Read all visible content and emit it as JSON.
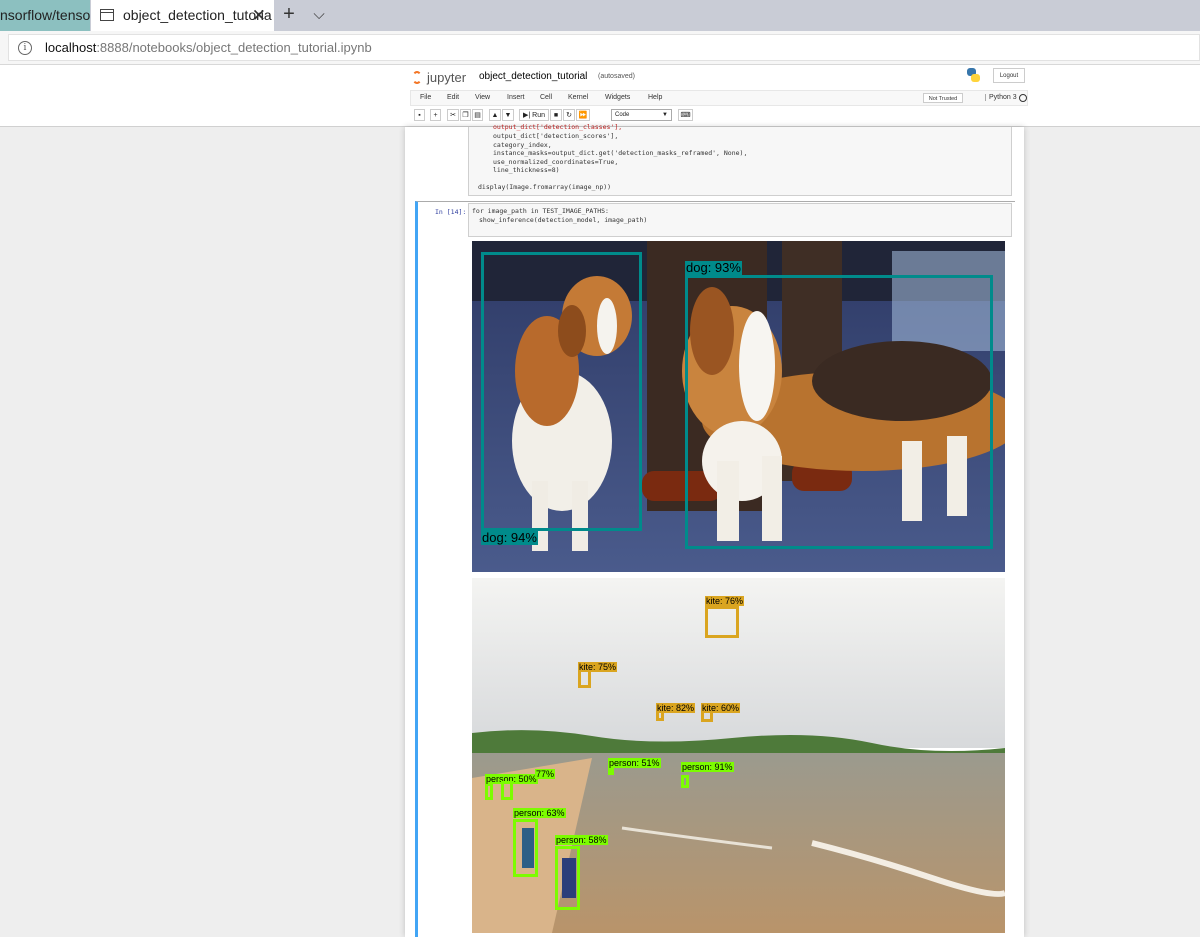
{
  "browser": {
    "tabs": [
      {
        "title": "nsorflow/tensorf"
      },
      {
        "title": "object_detection_tutoria"
      }
    ],
    "new_tab_symbol": "+",
    "tab_list_symbol": "⌵",
    "close_symbol": "✕",
    "url_host": "localhost",
    "url_path": ":8888/notebooks/object_detection_tutorial.ipynb"
  },
  "jupyter": {
    "logo_text": "jupyter",
    "notebook_name": "object_detection_tutorial",
    "save_status": "(autosaved)",
    "logout_label": "Logout",
    "menu": [
      "File",
      "Edit",
      "View",
      "Insert",
      "Cell",
      "Kernel",
      "Widgets",
      "Help"
    ],
    "trust_label": "Not Trusted",
    "kernel_name": "Python 3",
    "toolbar": {
      "run_label": "Run",
      "cell_type": "Code"
    }
  },
  "cells": {
    "prev_code_lines": [
      "output_dict['detection_classes'],",
      "output_dict['detection_scores'],",
      "category_index,",
      "instance_masks=output_dict.get('detection_masks_reframed', None),",
      "use_normalized_coordinates=True,",
      "line_thickness=8)",
      "",
      "display(Image.fromarray(image_np))"
    ],
    "current_prompt": "In [14]:",
    "current_code_line1": "for image_path in TEST_IMAGE_PATHS:",
    "current_code_line2": "show_inference(detection_model, image_path)"
  },
  "outputs": {
    "image1_detections": [
      {
        "label": "dog: 94%",
        "color": "#008b8b"
      },
      {
        "label": "dog: 93%",
        "color": "#008b8b"
      }
    ],
    "image2_detections": [
      {
        "label": "kite: 76%",
        "color": "#daa520"
      },
      {
        "label": "kite: 75%",
        "color": "#daa520"
      },
      {
        "label": "kite: 82%",
        "color": "#daa520"
      },
      {
        "label": "kite: 60%",
        "color": "#daa520"
      },
      {
        "label": "person: 51%",
        "color": "#7cfc00"
      },
      {
        "label": "person: 91%",
        "color": "#7cfc00"
      },
      {
        "label": "person: 50%",
        "color": "#7cfc00"
      },
      {
        "label": "77%",
        "color": "#7cfc00"
      },
      {
        "label": "person: 63%",
        "color": "#7cfc00"
      },
      {
        "label": "person: 58%",
        "color": "#7cfc00"
      }
    ]
  }
}
